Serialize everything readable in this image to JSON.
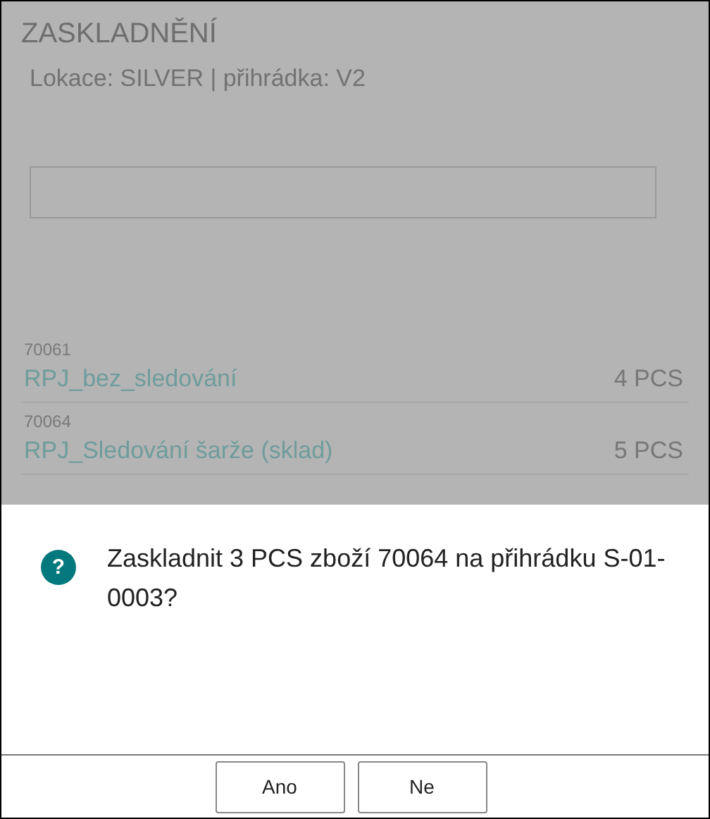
{
  "page": {
    "title": "ZASKLADNĚNÍ",
    "subtitle": "Lokace: SILVER | přihrádka: V2"
  },
  "items": [
    {
      "code": "70061",
      "name": "RPJ_bez_sledování",
      "quantity": "4 PCS"
    },
    {
      "code": "70064",
      "name": "RPJ_Sledování šarže (sklad)",
      "quantity": "5 PCS"
    }
  ],
  "dialog": {
    "icon": "?",
    "message": "Zaskladnit 3 PCS zboží 70064 na přihrádku S-01-0003?",
    "buttons": [
      "Ano",
      "Ne"
    ]
  }
}
